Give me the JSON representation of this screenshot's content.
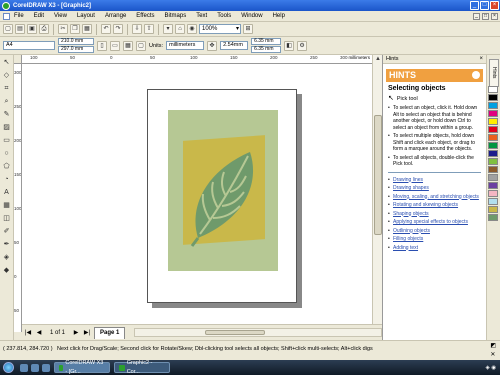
{
  "window": {
    "title": "CorelDRAW X3 - [Graphic2]",
    "buttons": {
      "minimize": "_",
      "maximize": "□",
      "close": "×"
    }
  },
  "menubar": {
    "items": [
      "File",
      "Edit",
      "View",
      "Layout",
      "Arrange",
      "Effects",
      "Bitmaps",
      "Text",
      "Tools",
      "Window",
      "Help"
    ]
  },
  "toolbar": {
    "zoom": "100%"
  },
  "propbar": {
    "paper_size": "A4",
    "width": "210.0 mm",
    "height": "297.0 mm",
    "units_label": "Units:",
    "units_value": "millimeters",
    "nudge": "2.54mm",
    "dup_x": "6.35 mm",
    "dup_y": "6.35 mm"
  },
  "rulers": {
    "horizontal_ticks": [
      "100",
      "50",
      "0",
      "50",
      "100",
      "150",
      "200",
      "250",
      "300"
    ],
    "units": "millimeters",
    "vertical_ticks": [
      "300",
      "250",
      "200",
      "150",
      "100",
      "50",
      "0",
      "50"
    ]
  },
  "pagebar": {
    "page_count": "1 of 1",
    "page_tab": "Page 1"
  },
  "docker": {
    "header": "Hints",
    "title": "HINTS",
    "section_title": "Selecting objects",
    "tool_name": "Pick tool",
    "instructions": [
      "To select an object, click it. Hold down Alt to select an object that is behind another object, or hold down Ctrl to select an object from within a group.",
      "To select multiple objects, hold down Shift and click each object, or drag to form a marquee around the objects.",
      "To select all objects, double-click the Pick tool."
    ],
    "links": [
      "Drawing lines",
      "Drawing shapes",
      "Moving, scaling, and stretching objects",
      "Rotating and skewing objects",
      "Shaping objects",
      "Applying special effects to objects",
      "Outlining objects",
      "Filling objects",
      "Adding text"
    ]
  },
  "statusbar": {
    "coords": "( 237.814, 284.720 )",
    "message": "Next click for Drag/Scale; Second click for Rotate/Skew; Dbl-clicking tool selects all objects; Shift+click multi-selects; Alt+click digs"
  },
  "taskbar": {
    "tasks": [
      "CorelDRAW X3 - [Gr...",
      "Graphic2 - Cor..."
    ]
  },
  "colors": {
    "accent": "#f0a040",
    "art_background": "#b6c894",
    "art_inner": "#c9b84a",
    "leaf": "#6f9a6b"
  }
}
